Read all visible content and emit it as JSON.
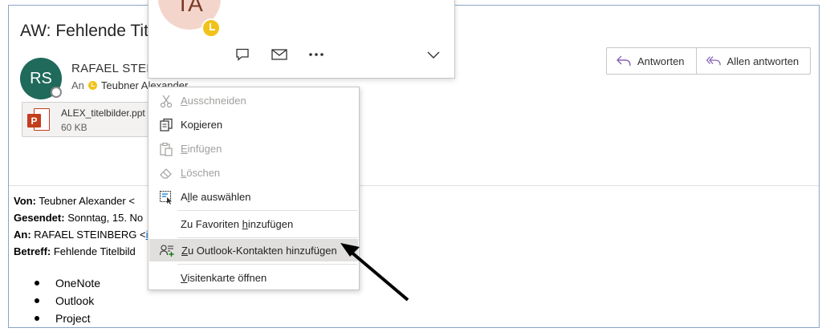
{
  "email": {
    "subject": "AW: Fehlende Tite",
    "sender": {
      "initials": "RS",
      "name": "RAFAEL STEIN",
      "to_label": "An",
      "to_name": "Teubner Alexander"
    },
    "attachment": {
      "name": "ALEX_titelbilder.ppt",
      "size": "60 KB"
    },
    "quoted_header": {
      "from_label": "Von:",
      "from_value": "Teubner Alexander <",
      "sent_label": "Gesendet:",
      "sent_value": "Sonntag, 15. No",
      "to_label": "An:",
      "to_value": "RAFAEL STEINBERG <",
      "to_link": "in",
      "subject_label": "Betreff:",
      "subject_value": "Fehlende Titelbild"
    },
    "bullets": [
      "OneNote",
      "Outlook",
      "Project"
    ]
  },
  "reply_buttons": {
    "reply": "Antworten",
    "reply_all": "Allen antworten"
  },
  "contact_card": {
    "initials": "TA",
    "actions": [
      "chat-icon",
      "mail-icon",
      "more-icon"
    ],
    "expand_icon": "chevron-down-icon"
  },
  "context_menu": {
    "items": [
      {
        "pre": "",
        "key": "A",
        "post": "usschneiden",
        "icon": "scissors-icon",
        "disabled": true
      },
      {
        "pre": "Ko",
        "key": "p",
        "post": "ieren",
        "icon": "copy-icon",
        "disabled": false
      },
      {
        "pre": "",
        "key": "E",
        "post": "infügen",
        "icon": "paste-icon",
        "disabled": true
      },
      {
        "pre": "",
        "key": "L",
        "post": "öschen",
        "icon": "eraser-icon",
        "disabled": true
      },
      {
        "pre": "A",
        "key": "l",
        "post": "le auswählen",
        "icon": "select-all-icon",
        "disabled": false
      },
      {
        "pre": "Zu Favoriten ",
        "key": "h",
        "post": "inzufügen",
        "icon": "",
        "disabled": false
      },
      {
        "pre": "",
        "key": "Z",
        "post": "u Outlook-Kontakten hinzufügen",
        "icon": "add-contact-icon",
        "disabled": false,
        "highlighted": true
      },
      {
        "pre": "",
        "key": "V",
        "post": "isitenkarte öffnen",
        "icon": "",
        "disabled": false
      }
    ]
  },
  "colors": {
    "avatar_bg": "#1f6a5a",
    "card_avatar_bg": "#f4d5cc",
    "presence_away": "#f1c21b",
    "reply_icon": "#8764b8",
    "ppt_red": "#c43e1c",
    "menu_highlight": "#e1dfdd"
  }
}
